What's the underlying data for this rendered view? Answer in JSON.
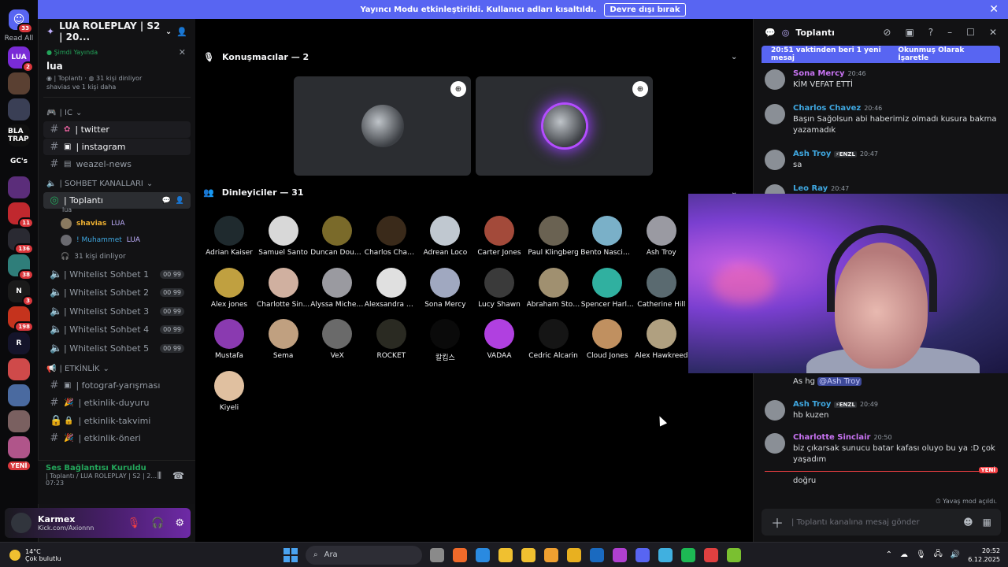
{
  "banner": {
    "text": "Yayıncı Modu etkinleştirildi. Kullanıcı adları kısaltıldı.",
    "button": "Devre dışı bırak"
  },
  "rail": {
    "dm_badge": "33",
    "read_all": "Read All",
    "new_label": "YENİ",
    "servers": [
      {
        "label": "LUA",
        "color": "#7a2bd6",
        "badge": "2"
      },
      {
        "label": "",
        "color": "#5a4032",
        "badge": ""
      },
      {
        "label": "",
        "color": "#3a3f55",
        "badge": ""
      },
      {
        "label": "BLA TRAP",
        "color": "#101010",
        "badge": ""
      },
      {
        "label": "GC's",
        "color": "#0a0a0c",
        "badge": ""
      },
      {
        "label": "",
        "color": "#5b2d7a",
        "badge": ""
      },
      {
        "label": "",
        "color": "#c0282e",
        "badge": "11"
      },
      {
        "label": "",
        "color": "#2a2a32",
        "badge": "136"
      },
      {
        "label": "",
        "color": "#2f7e7a",
        "badge": "38"
      },
      {
        "label": "N",
        "color": "#1a1a1a",
        "badge": "3"
      },
      {
        "label": "",
        "color": "#c5331d",
        "badge": "198"
      },
      {
        "label": "R",
        "color": "#14142a",
        "badge": ""
      },
      {
        "label": "",
        "color": "#cf4a4a",
        "badge": ""
      },
      {
        "label": "",
        "color": "#4a6aa0",
        "badge": ""
      },
      {
        "label": "",
        "color": "#7a6060",
        "badge": ""
      },
      {
        "label": "",
        "color": "#b0558a",
        "badge": ""
      }
    ]
  },
  "sidebar": {
    "server_name": "LUA ROLEPLAY | S2 | 20...",
    "live": {
      "status": "Şimdi Yayında",
      "name": "lua",
      "channel": "| Toplantı",
      "listeners": "31 kişi dinliyor",
      "viewers": "shavias ve 1 kişi daha"
    },
    "categories": [
      {
        "name": "| IC"
      },
      {
        "name": "| SOHBET KANALLARI"
      },
      {
        "name": "| ETKİNLİK"
      }
    ],
    "ic_channels": [
      "| twitter",
      "| instagram",
      "weazel-news"
    ],
    "voice_active": {
      "name": "| Toplantı",
      "sub": "lua",
      "users": [
        "shavias",
        "! Muhammet"
      ],
      "user_tag": "LUA",
      "listening": "31 kişi dinliyor"
    },
    "sohbet": [
      {
        "name": "| Whitelist Sohbet 1",
        "a": "00",
        "b": "99"
      },
      {
        "name": "| Whitelist Sohbet 2",
        "a": "00",
        "b": "99"
      },
      {
        "name": "| Whitelist Sohbet 3",
        "a": "00",
        "b": "99"
      },
      {
        "name": "| Whitelist Sohbet 4",
        "a": "00",
        "b": "99"
      },
      {
        "name": "| Whitelist Sohbet 5",
        "a": "00",
        "b": "99"
      }
    ],
    "etkinlik": [
      "| fotograf-yarışması",
      "| etkinlik-duyuru",
      "| etkinlik-takvimi",
      "| etkinlik-öneri"
    ]
  },
  "voice_status": {
    "title": "Ses Bağlantısı Kuruldu",
    "sub": "| Toplantı / LUA ROLEPLAY | S2 | 2...",
    "timer": "07:23"
  },
  "user": {
    "name": "Karmex",
    "sub": "Kick.com/Axionnn"
  },
  "main": {
    "speakers_title": "Konuşmacılar — 2",
    "listeners_title": "Dinleyiciler — 31",
    "listeners": [
      {
        "name": "Adrian Kaiser",
        "color": "#1f2a2e"
      },
      {
        "name": "Samuel Santo",
        "color": "#d8d8d8"
      },
      {
        "name": "Duncan Dougl...",
        "color": "#7a6a2a"
      },
      {
        "name": "Charlos Chavez",
        "color": "#3a2a1a"
      },
      {
        "name": "Adrean Loco",
        "color": "#c0c8d0"
      },
      {
        "name": "Carter Jones",
        "color": "#a34a3a"
      },
      {
        "name": "Paul Klingberg",
        "color": "#6a6252"
      },
      {
        "name": "Bento Nascim...",
        "color": "#7ab0c8"
      },
      {
        "name": "Ash Troy",
        "color": "#9a9aa2"
      },
      {
        "name": "Alex jones",
        "color": "#c0a040"
      },
      {
        "name": "Charlotte Sin...",
        "color": "#d0b0a0"
      },
      {
        "name": "Alyssa Michel...",
        "color": "#9a9aa0"
      },
      {
        "name": "Alexsandra Mi...",
        "color": "#e0e0e0"
      },
      {
        "name": "Sona Mercy",
        "color": "#a0a8c0"
      },
      {
        "name": "Lucy Shawn",
        "color": "#3a3a3a"
      },
      {
        "name": "Abraham Stone",
        "color": "#a09070"
      },
      {
        "name": "Spencer Harl...",
        "color": "#30b0a0"
      },
      {
        "name": "Catherine Hill",
        "color": "#5a6a70"
      },
      {
        "name": "Mustafa",
        "color": "#8a3ab0"
      },
      {
        "name": "Sema",
        "color": "#c0a080"
      },
      {
        "name": "VeX",
        "color": "#6a6a6a"
      },
      {
        "name": "ROCKET",
        "color": "#2a2a22"
      },
      {
        "name": "칼킵스",
        "color": "#0a0a0a"
      },
      {
        "name": "VADAA",
        "color": "#b040e0"
      },
      {
        "name": "Cedric Alcarin",
        "color": "#151515"
      },
      {
        "name": "Cloud Jones",
        "color": "#c09060"
      },
      {
        "name": "Alex Hawkreed",
        "color": "#b0a080"
      },
      {
        "name": "Kiyeli",
        "color": "#e0c0a0"
      }
    ]
  },
  "chat": {
    "title": "Toplantı",
    "new_since": "20:51 vaktinden beri 1 yeni mesaj",
    "mark_read": "Okunmuş Olarak İşaretle",
    "messages": [
      {
        "who": "Sona Mercy",
        "color": "#c873f2",
        "time": "20:46",
        "text": "KİM VEFAT ETTİ"
      },
      {
        "who": "Charlos Chavez",
        "color": "#3fa7e0",
        "time": "20:46",
        "text": "Başın Sağolsun abi haberimiz olmadı kusura bakma yazamadık"
      },
      {
        "who": "Ash Troy",
        "color": "#3fa7e0",
        "time": "20:47",
        "text": "sa",
        "tag": "ENZL"
      },
      {
        "who": "Leo Ray",
        "color": "#3fa7e0",
        "time": "20:47",
        "text": ""
      },
      {
        "who": "",
        "color": "#3fa7e0",
        "time": "",
        "text": "As hg",
        "mention": "@Ash Troy"
      },
      {
        "who": "Ash Troy",
        "color": "#3fa7e0",
        "time": "20:49",
        "text": "hb kuzen",
        "tag": "ENZL"
      },
      {
        "who": "Charlotte Sinclair",
        "color": "#c873f2",
        "time": "20:50",
        "text": "biz çıkarsak sunucu batar kafası oluyo bu ya :D çok yaşadım"
      },
      {
        "who": "",
        "color": "#3fa7e0",
        "time": "",
        "text": "doğru"
      }
    ],
    "new_label": "YENİ",
    "slowmode": "Yavaş mod açıldı.",
    "placeholder": "| Toplantı kanalına mesaj gönder"
  },
  "taskbar": {
    "temp": "14°C",
    "weather": "Çok bulutlu",
    "search": "Ara",
    "time": "20:52",
    "date": "6.12.2025",
    "app_colors": [
      "#8a8a8a",
      "#f06a2a",
      "#2a8ae0",
      "#f0c030",
      "#f0c030",
      "#f0a030",
      "#e8b020",
      "#1a6ac0",
      "#b040d0",
      "#5865f2",
      "#40b0e0",
      "#1db954",
      "#e04040",
      "#7ac030"
    ]
  }
}
